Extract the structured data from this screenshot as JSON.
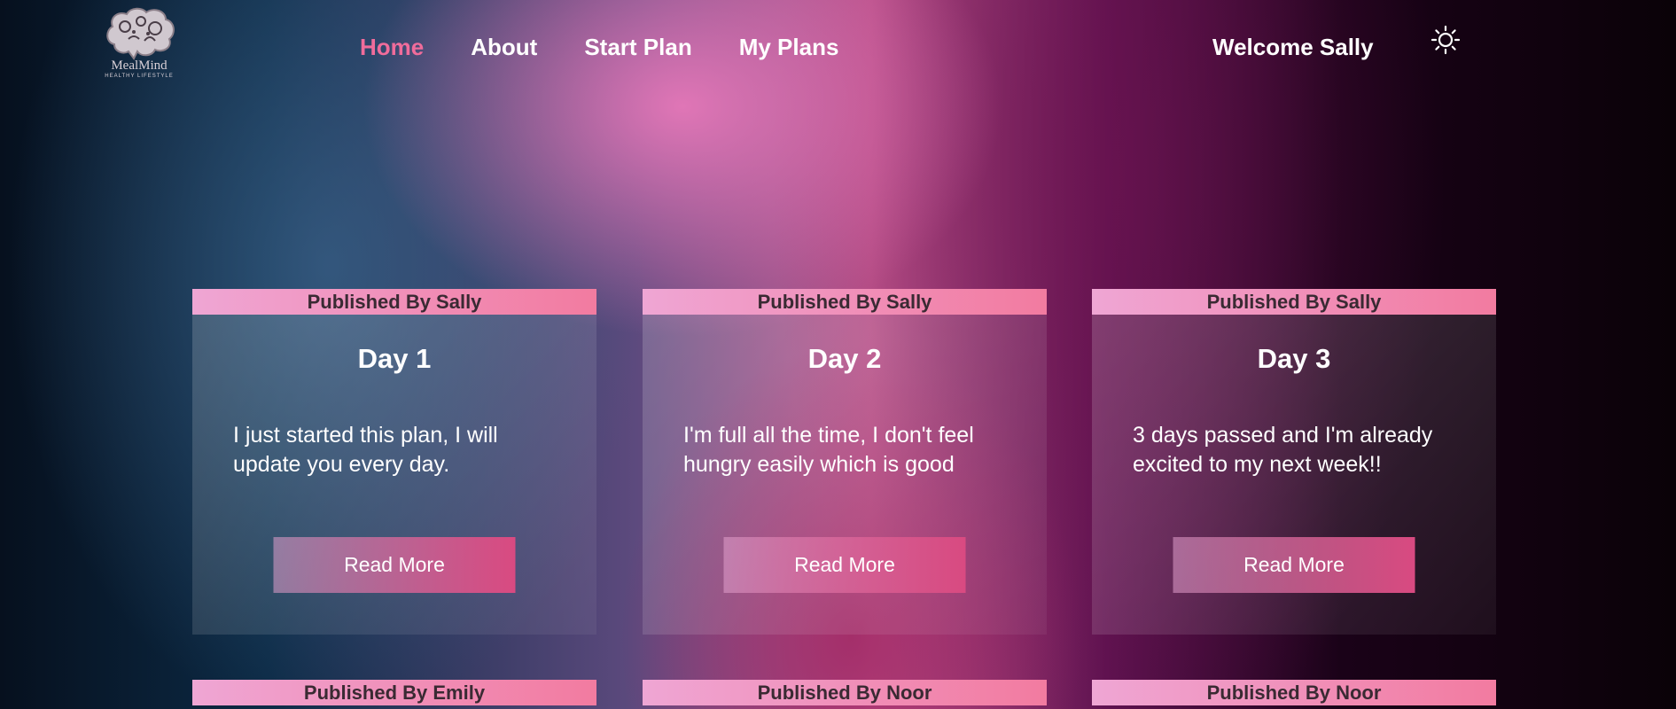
{
  "brand": {
    "name": "MealMind",
    "tagline": "HEALTHY LIFESTYLE"
  },
  "nav": {
    "items": [
      {
        "label": "Home",
        "active": true
      },
      {
        "label": "About",
        "active": false
      },
      {
        "label": "Start Plan",
        "active": false
      },
      {
        "label": "My Plans",
        "active": false
      }
    ]
  },
  "user": {
    "welcome": "Welcome Sally"
  },
  "theme_toggle": {
    "icon": "sun-icon"
  },
  "colors": {
    "accent": "#f06c9b",
    "header_gradient_start": "#efa6d4",
    "header_gradient_end": "#f27ba0"
  },
  "cards": [
    {
      "publisher": "Published By Sally",
      "title": "Day 1",
      "body": "I just started this plan, I will update you every day.",
      "button": "Read More"
    },
    {
      "publisher": "Published By Sally",
      "title": "Day 2",
      "body": "I'm full all the time, I don't feel hungry easily which is good",
      "button": "Read More"
    },
    {
      "publisher": "Published By Sally",
      "title": "Day 3",
      "body": "3 days passed and I'm already excited to my next week!!",
      "button": "Read More"
    }
  ],
  "next_row": [
    {
      "publisher": "Published By Emily"
    },
    {
      "publisher": "Published By Noor"
    },
    {
      "publisher": "Published By Noor"
    }
  ]
}
